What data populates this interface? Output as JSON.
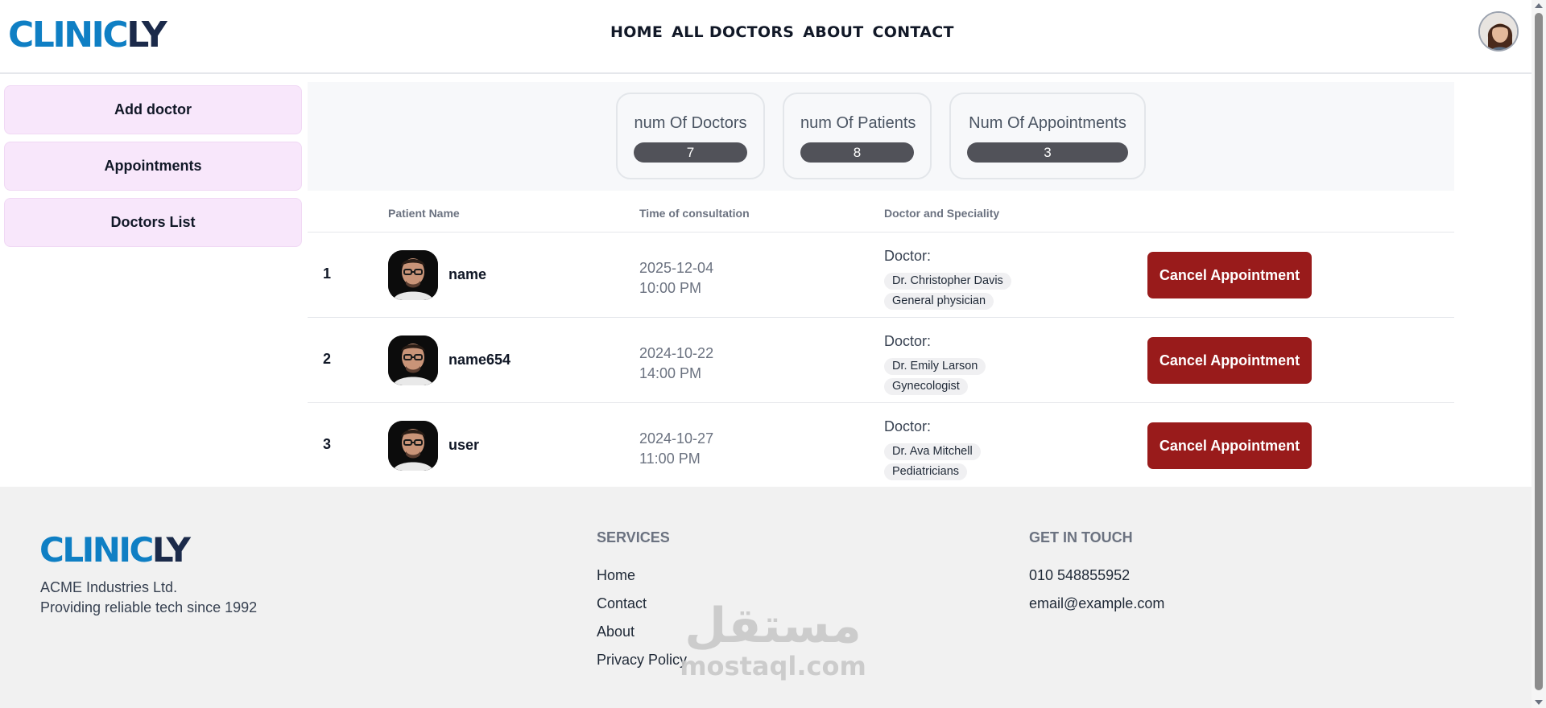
{
  "brand": {
    "part1": "CLINIC",
    "part2": "LY"
  },
  "nav": {
    "items": [
      "HOME",
      "ALL DOCTORS",
      "ABOUT",
      "CONTACT"
    ]
  },
  "sidebar": {
    "items": [
      "Add doctor",
      "Appointments",
      "Doctors List"
    ]
  },
  "stats": [
    {
      "label": "num Of Doctors",
      "value": "7"
    },
    {
      "label": "num Of Patients",
      "value": "8"
    },
    {
      "label": "Num Of Appointments",
      "value": "3"
    }
  ],
  "table": {
    "headers": [
      "Patient Name",
      "Time of consultation",
      "Doctor and Speciality"
    ],
    "doctor_label": "Doctor:",
    "cancel_label": "Cancel Appointment",
    "rows": [
      {
        "index": "1",
        "name": "name",
        "date": "2025-12-04",
        "time": "10:00 PM",
        "doctor": "Dr. Christopher Davis",
        "speciality": "General physician"
      },
      {
        "index": "2",
        "name": "name654",
        "date": "2024-10-22",
        "time": "14:00 PM",
        "doctor": "Dr. Emily Larson",
        "speciality": "Gynecologist"
      },
      {
        "index": "3",
        "name": "user",
        "date": "2024-10-27",
        "time": "11:00 PM",
        "doctor": "Dr. Ava Mitchell",
        "speciality": "Pediatricians"
      }
    ]
  },
  "footer": {
    "company": "ACME Industries Ltd.",
    "tagline": "Providing reliable tech since 1992",
    "services_title": "SERVICES",
    "services": [
      "Home",
      "Contact",
      "About",
      "Privacy Policy"
    ],
    "contact_title": "GET IN TOUCH",
    "phone": "010 548855952",
    "email": "email@example.com"
  },
  "watermark": {
    "arabic": "مستقل",
    "latin": "mostaql.com"
  },
  "colors": {
    "brand_blue": "#0f7fc4",
    "brand_navy": "#1b2a4a",
    "sidebar_bg": "#f8e7fb",
    "cancel_red": "#991b1b",
    "stat_pill": "#515259"
  }
}
